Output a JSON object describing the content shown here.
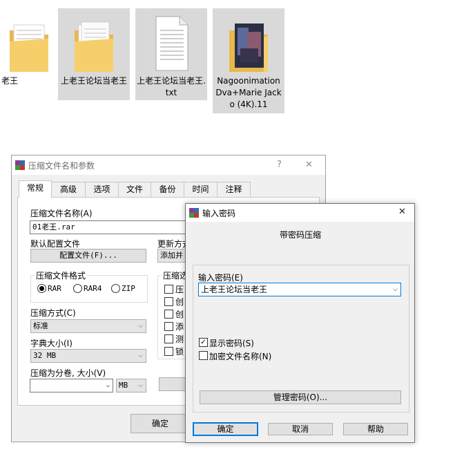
{
  "desktop": {
    "files": [
      {
        "name": "老王",
        "kind": "folder"
      },
      {
        "name": "上老王论坛当老王",
        "kind": "folder"
      },
      {
        "name": "上老王论坛当老王.txt",
        "kind": "text-file"
      },
      {
        "name": "Nagoonimation Dva+Marie Jacko (4K).11",
        "kind": "folder-with-image"
      }
    ]
  },
  "main_dialog": {
    "title": "压缩文件名和参数",
    "help_button": "?",
    "close_button": "✕",
    "tabs": [
      "常规",
      "高级",
      "选项",
      "文件",
      "备份",
      "时间",
      "注释"
    ],
    "archive_name_label": "压缩文件名称(A)",
    "archive_name_value": "01老王.rar",
    "default_profile_label": "默认配置文件",
    "profile_button": "配置文件(F)...",
    "update_mode_label": "更新方式",
    "update_mode_value": "添加并",
    "format_group_label": "压缩文件格式",
    "format_options": [
      "RAR",
      "RAR4",
      "ZIP"
    ],
    "format_selected": "RAR",
    "method_label": "压缩方式(C)",
    "method_value": "标准",
    "dict_label": "字典大小(I)",
    "dict_value": "32 MB",
    "split_label": "压缩为分卷, 大小(V)",
    "split_value": "",
    "split_unit": "MB",
    "options_group_label": "压缩选",
    "options_items": [
      "压",
      "创",
      "创",
      "添",
      "测",
      "锁"
    ],
    "ok_button": "确定"
  },
  "password_dialog": {
    "title": "输入密码",
    "close_button": "✕",
    "heading": "带密码压缩",
    "password_label": "输入密码(E)",
    "password_value": "上老王论坛当老王",
    "show_password_label": "显示密码(S)",
    "show_password_checked": true,
    "encrypt_names_label": "加密文件名称(N)",
    "encrypt_names_checked": false,
    "manage_button": "管理密码(O)...",
    "ok_button": "确定",
    "cancel_button": "取消",
    "help_button": "帮助"
  },
  "colors": {
    "selection": "#d9d9d9",
    "folder": "#f6cf6b",
    "dialog_bg": "#f0f0f0",
    "focus_border": "#0078d7"
  }
}
